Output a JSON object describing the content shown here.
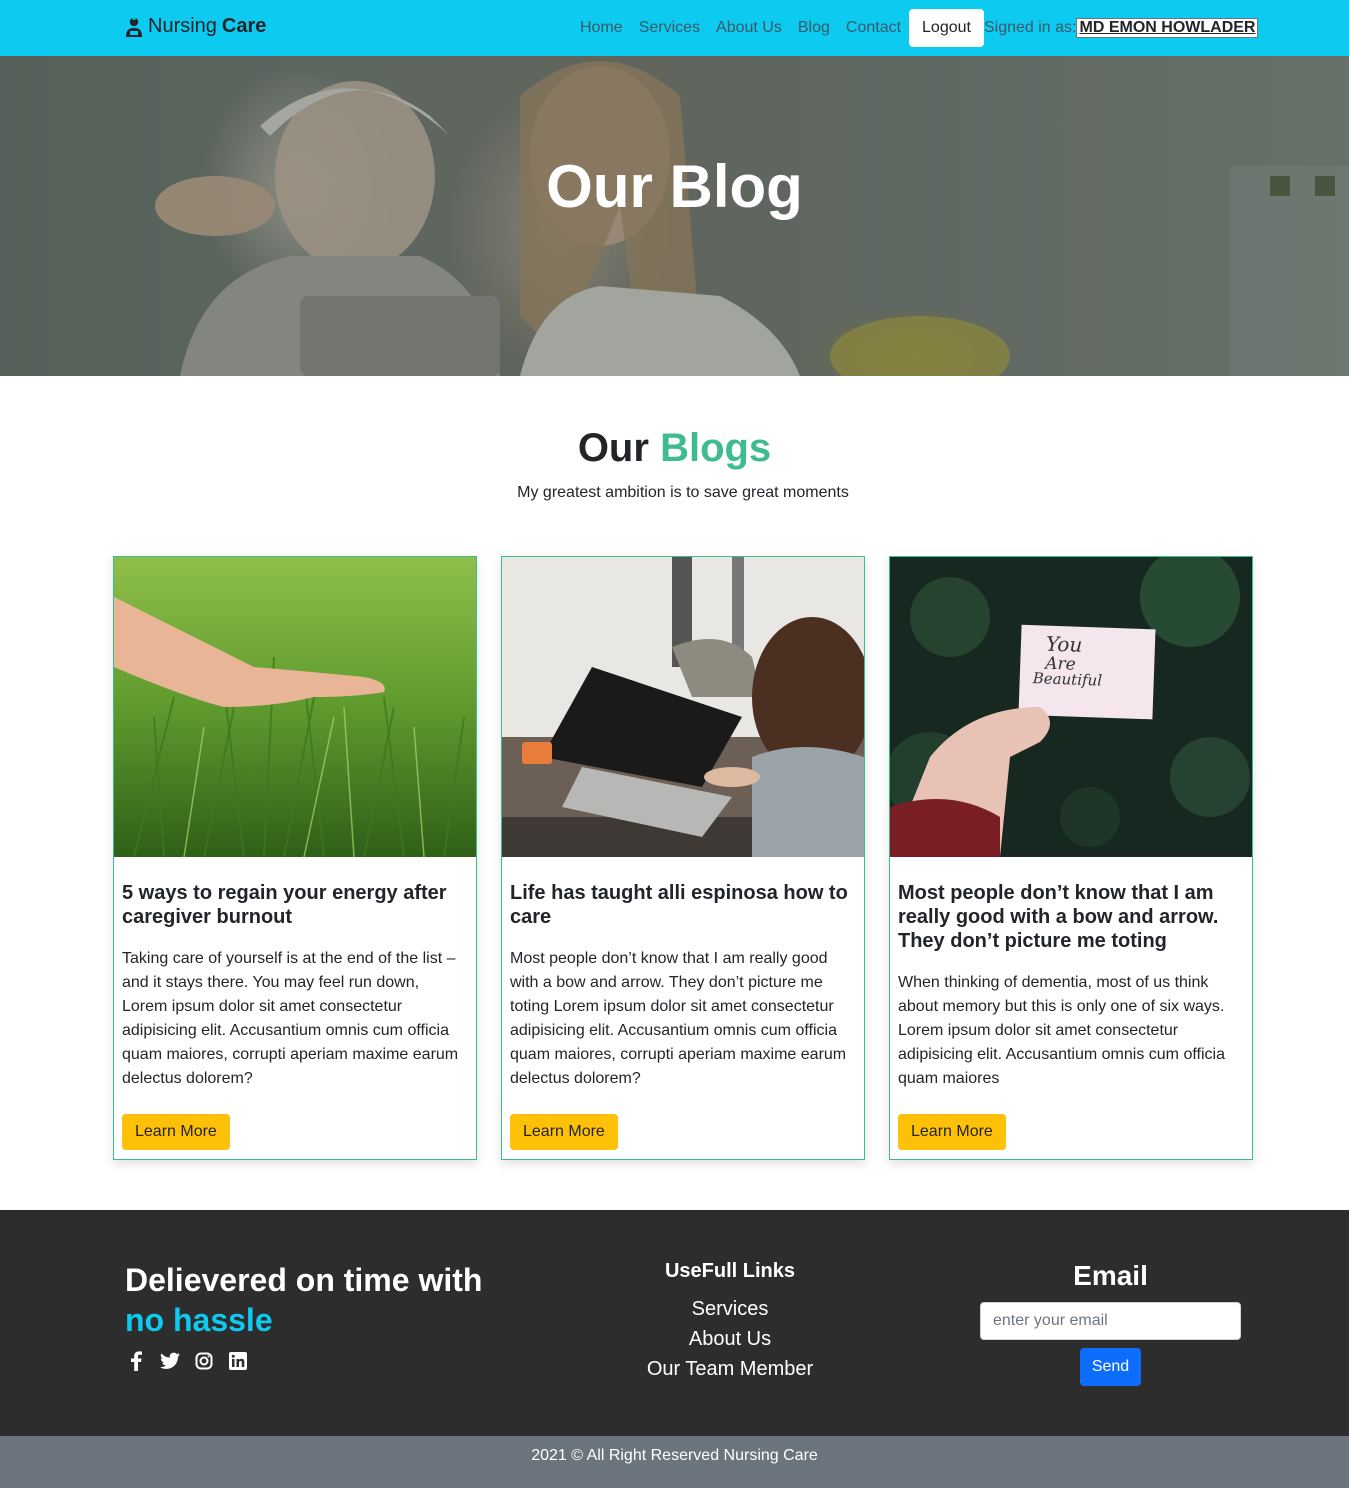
{
  "navbar": {
    "brand_prefix": "Nursing",
    "brand_suffix": "Care",
    "brand_icon": "nurse-icon",
    "links": [
      "Home",
      "Services",
      "About Us",
      "Blog",
      "Contact"
    ],
    "logout_label": "Logout",
    "signed_in_label": "Signed in as:",
    "user_name": " MD EMON HOWLADER"
  },
  "hero": {
    "title": "Our Blog"
  },
  "section": {
    "title_main": "Our",
    "title_accent": "Blogs",
    "subtitle": "My greatest ambition is to save great moments"
  },
  "cards": [
    {
      "title": "5 ways to regain your energy after caregiver burnout",
      "text": "Taking care of yourself is at the end of the list – and it stays there. You may feel run down, Lorem ipsum dolor sit amet consectetur adipisicing elit. Accusantium omnis cum officia quam maiores, corrupti aperiam maxime earum delectus dolorem?",
      "button": "Learn More"
    },
    {
      "title": "Life has taught alli espinosa how to care",
      "text": "Most people don’t know that I am really good with a bow and arrow. They don’t picture me toting Lorem ipsum dolor sit amet consectetur adipisicing elit. Accusantium omnis cum officia quam maiores, corrupti aperiam maxime earum delectus dolorem?",
      "button": "Learn More"
    },
    {
      "title": "Most people don’t know that I am really good with a bow and arrow. They don’t picture me toting",
      "text": "When thinking of dementia, most of us think about memory but this is only one of six ways. Lorem ipsum dolor sit amet consectetur adipisicing elit. Accusantium omnis cum officia quam maiores",
      "button": "Learn More",
      "image_note_lines": [
        "You",
        "Are",
        "Beautiful"
      ]
    }
  ],
  "footer": {
    "headline_main": "Delievered on time with",
    "headline_accent": "no hassle",
    "socials": [
      "facebook-icon",
      "twitter-icon",
      "instagram-icon",
      "linkedin-icon"
    ],
    "links_title": "UseFull Links",
    "links": [
      "Services",
      "About Us",
      "Our Team Member"
    ],
    "email_title": "Email",
    "email_placeholder": "enter your email",
    "send_label": "Send",
    "copyright": "2021 © All Right Reserved Nursing Care"
  },
  "colors": {
    "navbar": "#0dcaf0",
    "accent_green": "#3ebb8f",
    "button_yellow": "#ffc107",
    "footer_bg": "#2d2d2d",
    "copyright_bg": "#6c757d",
    "send_blue": "#0d6efd"
  }
}
